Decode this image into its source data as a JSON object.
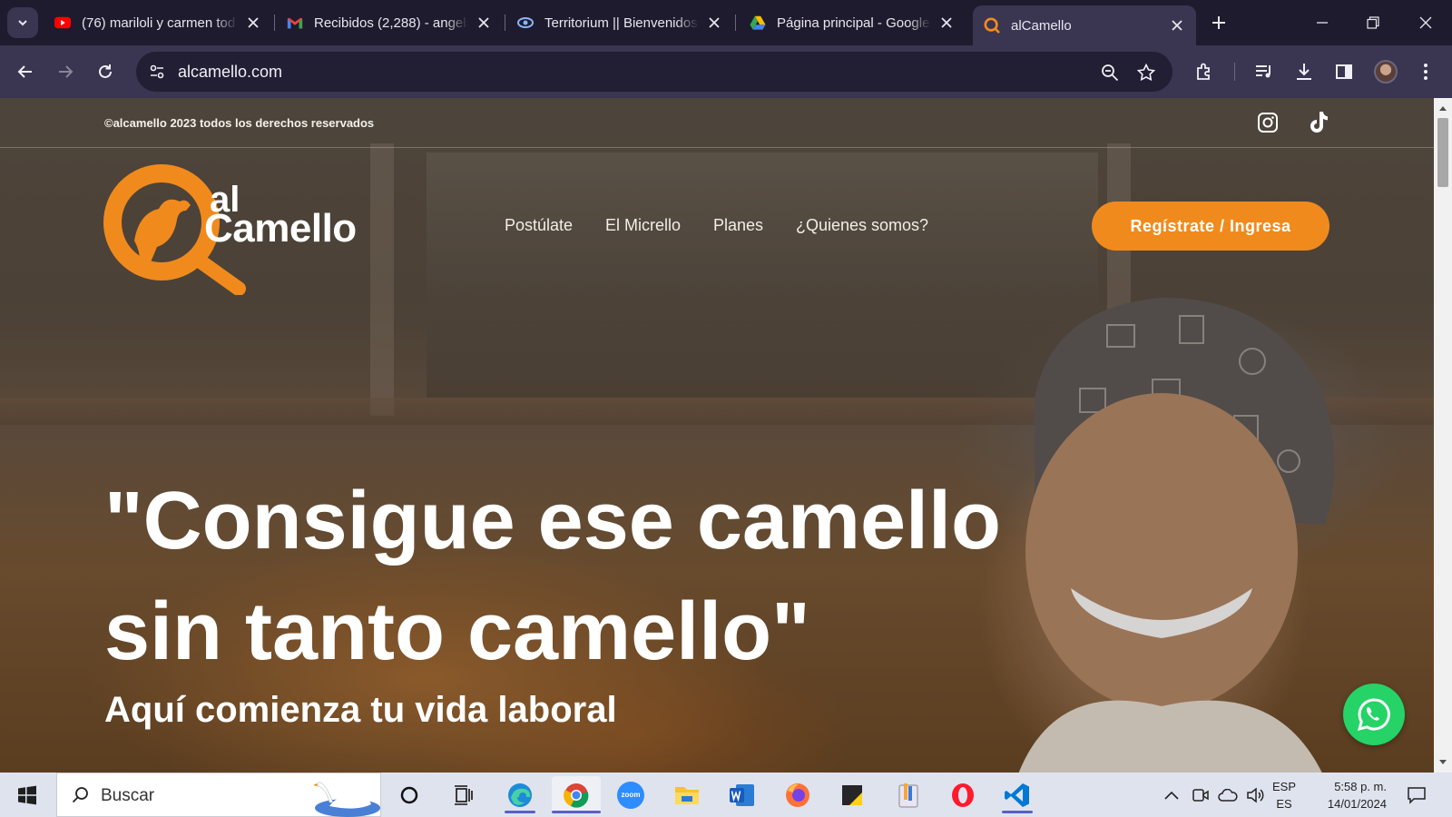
{
  "browser": {
    "tabs": [
      {
        "title": "(76) mariloli y carmen tod",
        "icon": "youtube-icon",
        "color": "#ff0000"
      },
      {
        "title": "Recibidos (2,288) - angela",
        "icon": "gmail-icon",
        "color": "#ea4335"
      },
      {
        "title": "Territorium || Bienvenidos",
        "icon": "territorium-icon",
        "color": "#8ab4f8"
      },
      {
        "title": "Página principal - Google",
        "icon": "google-drive-icon",
        "color": "#34a853"
      },
      {
        "title": "alCamello",
        "icon": "alcamello-icon",
        "color": "#f18a1c",
        "active": true
      }
    ],
    "url": "alcamello.com"
  },
  "page": {
    "copyright": "©alcamello 2023 todos los derechos reservados",
    "logo": {
      "al": "al",
      "camello": "Camello",
      "accent": "#f18a1c"
    },
    "nav": [
      "Postúlate",
      "El Micrello",
      "Planes",
      "¿Quienes somos?"
    ],
    "cta": "Regístrate / Ingresa",
    "headline_line1": "\"Consigue ese camello",
    "headline_line2": "sin tanto camello\"",
    "subheadline": "Aquí comienza tu vida laboral",
    "social": [
      "instagram-icon",
      "tiktok-icon"
    ],
    "whatsapp_color": "#25d366"
  },
  "taskbar": {
    "search_placeholder": "Buscar",
    "apps": [
      "cortana-icon",
      "task-view-icon",
      "edge-icon",
      "chrome-icon",
      "zoom-icon",
      "file-explorer-icon",
      "word-icon",
      "firefox-icon",
      "sticky-notes-icon",
      "paint-icon",
      "opera-icon",
      "vscode-icon"
    ],
    "zoom_label": "zoom",
    "lang_top": "ESP",
    "lang_bottom": "ES",
    "time": "5:58 p. m.",
    "date": "14/01/2024"
  }
}
